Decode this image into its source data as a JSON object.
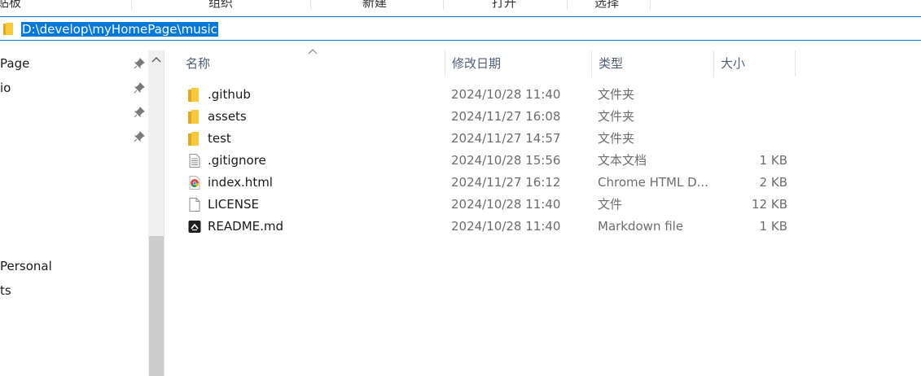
{
  "ribbon": {
    "groups": [
      {
        "label": "贴板"
      },
      {
        "label": "组织"
      },
      {
        "label": "新建"
      },
      {
        "label": "打开"
      },
      {
        "label": "选择"
      }
    ]
  },
  "address": {
    "path": "D:\\develop\\myHomePage\\music"
  },
  "nav": {
    "items": [
      {
        "label": "Page",
        "pinned": true
      },
      {
        "label": "io",
        "pinned": true
      },
      {
        "label": "",
        "pinned": true
      },
      {
        "label": "",
        "pinned": true
      },
      {
        "label": "Personal",
        "pinned": false
      },
      {
        "label": "ts",
        "pinned": false
      }
    ]
  },
  "columns": {
    "name": "名称",
    "date": "修改日期",
    "type": "类型",
    "size": "大小"
  },
  "files": [
    {
      "name": ".github",
      "date": "2024/10/28 11:40",
      "type": "文件夹",
      "size": "",
      "icon": "folder-icon"
    },
    {
      "name": "assets",
      "date": "2024/11/27 16:08",
      "type": "文件夹",
      "size": "",
      "icon": "folder-icon"
    },
    {
      "name": "test",
      "date": "2024/11/27 14:57",
      "type": "文件夹",
      "size": "",
      "icon": "folder-icon"
    },
    {
      "name": ".gitignore",
      "date": "2024/10/28 15:56",
      "type": "文本文档",
      "size": "1 KB",
      "icon": "text-file-icon"
    },
    {
      "name": "index.html",
      "date": "2024/11/27 16:12",
      "type": "Chrome HTML D...",
      "size": "2 KB",
      "icon": "chrome-icon"
    },
    {
      "name": "LICENSE",
      "date": "2024/10/28 11:40",
      "type": "文件",
      "size": "12 KB",
      "icon": "blank-file-icon"
    },
    {
      "name": "README.md",
      "date": "2024/10/28 11:40",
      "type": "Markdown file",
      "size": "1 KB",
      "icon": "markdown-icon"
    }
  ],
  "colors": {
    "accent": "#0078d7",
    "folder": "#f8c93e",
    "header_text": "#4c607a"
  }
}
